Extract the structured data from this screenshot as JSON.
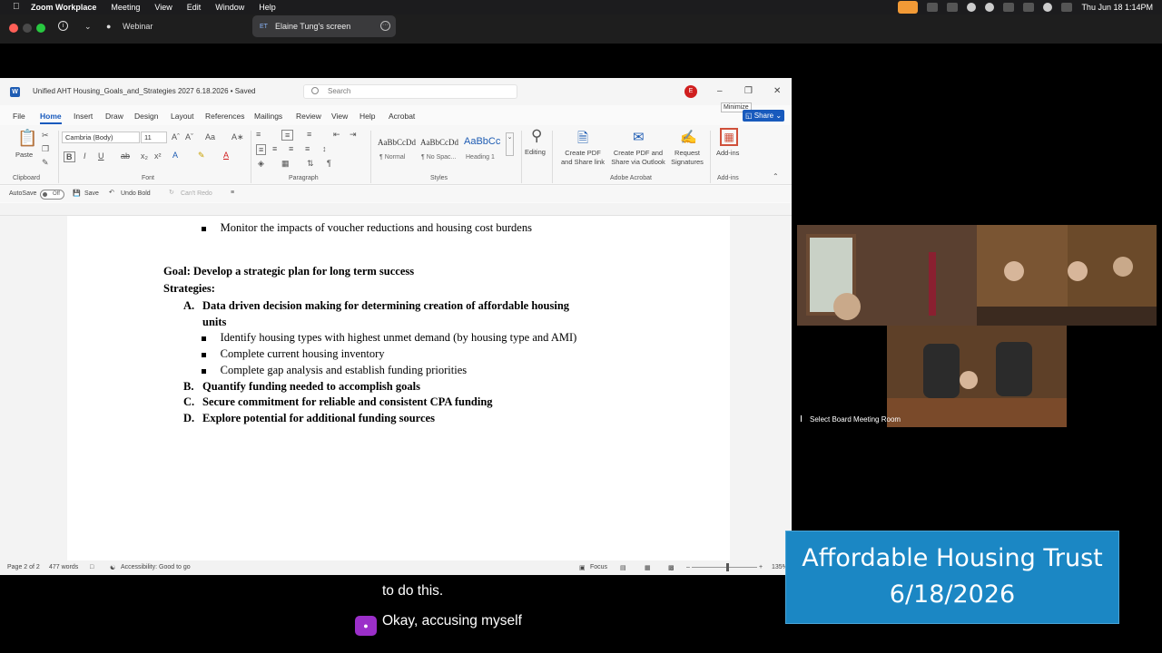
{
  "menubar": {
    "app_name": "Zoom Workplace",
    "items": [
      "Meeting",
      "View",
      "Edit",
      "Window",
      "Help"
    ],
    "datetime": "Thu Jun 18  1:14PM"
  },
  "zoom": {
    "webinar_label": "Webinar",
    "share_initials": "ET",
    "share_label": "Elaine Tung's screen"
  },
  "word": {
    "doc_title": "Unified AHT Housing_Goals_and_Strategies 2027 6.18.2026 • Saved",
    "search_placeholder": "Search",
    "avatar_initial": "E",
    "minimize_tooltip": "Minimize",
    "tabs": [
      "File",
      "Home",
      "Insert",
      "Draw",
      "Design",
      "Layout",
      "References",
      "Mailings",
      "Review",
      "View",
      "Help",
      "Acrobat"
    ],
    "active_tab": "Home",
    "share_label": "Share",
    "ribbon": {
      "paste": "Paste",
      "font_name": "Cambria (Body)",
      "font_size": "11",
      "clipboard_label": "Clipboard",
      "font_label": "Font",
      "paragraph_label": "Paragraph",
      "styles_label": "Styles",
      "styles": [
        {
          "sample": "AaBbCcDd",
          "name": "¶ Normal"
        },
        {
          "sample": "AaBbCcDd",
          "name": "¶ No Spac..."
        },
        {
          "sample": "AaBbCc",
          "name": "Heading 1"
        }
      ],
      "editing": "Editing",
      "create_pdf_link": "Create PDF and Share link",
      "create_pdf_outlook": "Create PDF and Share via Outlook",
      "request_signatures": "Request Signatures",
      "adobe_label": "Adobe Acrobat",
      "addins": "Add-ins",
      "addins_label": "Add-ins"
    },
    "quickbar": {
      "autosave": "AutoSave",
      "toggle": "Off",
      "save": "Save",
      "undo": "Undo Bold",
      "redo": "Can't Redo"
    },
    "document": {
      "bullet_top": "Monitor the impacts of voucher reductions and housing cost burdens",
      "goal": "Goal: Develop a strategic plan for long term success",
      "strategies": "Strategies:",
      "a_letter": "A.",
      "a_text_1": "Data driven decision making for determining creation of affordable housing",
      "a_text_2": "units",
      "bullets": [
        "Identify housing types with highest unmet demand (by housing type and AMI)",
        "Complete current housing inventory",
        "Complete gap analysis and establish funding priorities"
      ],
      "b_letter": "B.",
      "b_text": "Quantify funding needed to accomplish goals",
      "c_letter": "C.",
      "c_text": "Secure commitment for reliable and consistent CPA funding",
      "d_letter": "D.",
      "d_text": "Explore potential for additional funding sources"
    },
    "status": {
      "page": "Page 2 of 2",
      "words": "477 words",
      "accessibility": "Accessibility: Good to go",
      "focus": "Focus",
      "zoom": "135%"
    }
  },
  "video": {
    "label": "Select Board Meeting Room"
  },
  "captions": {
    "line1": "to do this.",
    "line2": "Okay, accusing myself"
  },
  "overlay": {
    "line1": "Affordable Housing Trust",
    "line2": "6/18/2026"
  },
  "colors": {
    "word_blue": "#185abd",
    "overlay_blue": "#1b87c4",
    "caption_avatar": "#9b2fc9"
  }
}
